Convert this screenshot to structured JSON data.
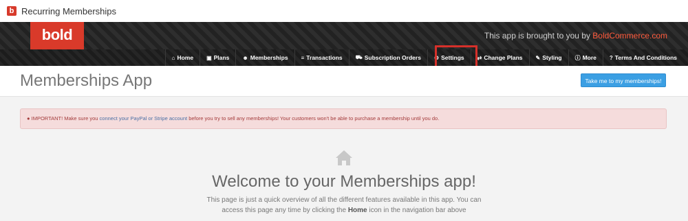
{
  "window": {
    "title": "Recurring Memberships",
    "badge_letter": "b"
  },
  "header": {
    "logo": "bold",
    "brought_prefix": "This app is brought to you by ",
    "brought_link": "BoldCommerce.com"
  },
  "nav": {
    "items": [
      {
        "label": "Home",
        "icon": "home-icon",
        "glyph": "⌂"
      },
      {
        "label": "Plans",
        "icon": "plans-icon",
        "glyph": "▣"
      },
      {
        "label": "Memberships",
        "icon": "users-icon",
        "glyph": "☻"
      },
      {
        "label": "Transactions",
        "icon": "list-icon",
        "glyph": "≡"
      },
      {
        "label": "Subscription Orders",
        "icon": "cart-icon",
        "glyph": "⛟"
      },
      {
        "label": "Settings",
        "icon": "gears-icon",
        "glyph": "⚙"
      },
      {
        "label": "Change Plans",
        "icon": "exchange-icon",
        "glyph": "⇄"
      },
      {
        "label": "Styling",
        "icon": "brush-icon",
        "glyph": "✎"
      },
      {
        "label": "More",
        "icon": "info-icon",
        "glyph": "ⓘ"
      },
      {
        "label": "Terms And Conditions",
        "icon": "question-icon",
        "glyph": "?"
      }
    ],
    "highlighted": "Settings"
  },
  "page": {
    "title": "Memberships App",
    "cta_label": "Take me to my memberships!"
  },
  "alert": {
    "glyph": "●",
    "prefix": " IMPORTANT! Make sure you ",
    "link": "connect your PayPal or Stripe account",
    "suffix": " before you try to sell any memberships! Your customers won't be able to purchase a membership until you do."
  },
  "welcome": {
    "heading": "Welcome to your Memberships app!",
    "line1": "This page is just a quick overview of all the different features available in this app. You can",
    "line2_prefix": "access this page any time by clicking the ",
    "line2_bold": "Home",
    "line2_suffix": " icon in the navigation bar above"
  },
  "colors": {
    "brand_red": "#d93a2a",
    "button_blue": "#3b9fe3",
    "alert_bg": "#f5dcdc",
    "highlight_border": "#d6302a"
  }
}
